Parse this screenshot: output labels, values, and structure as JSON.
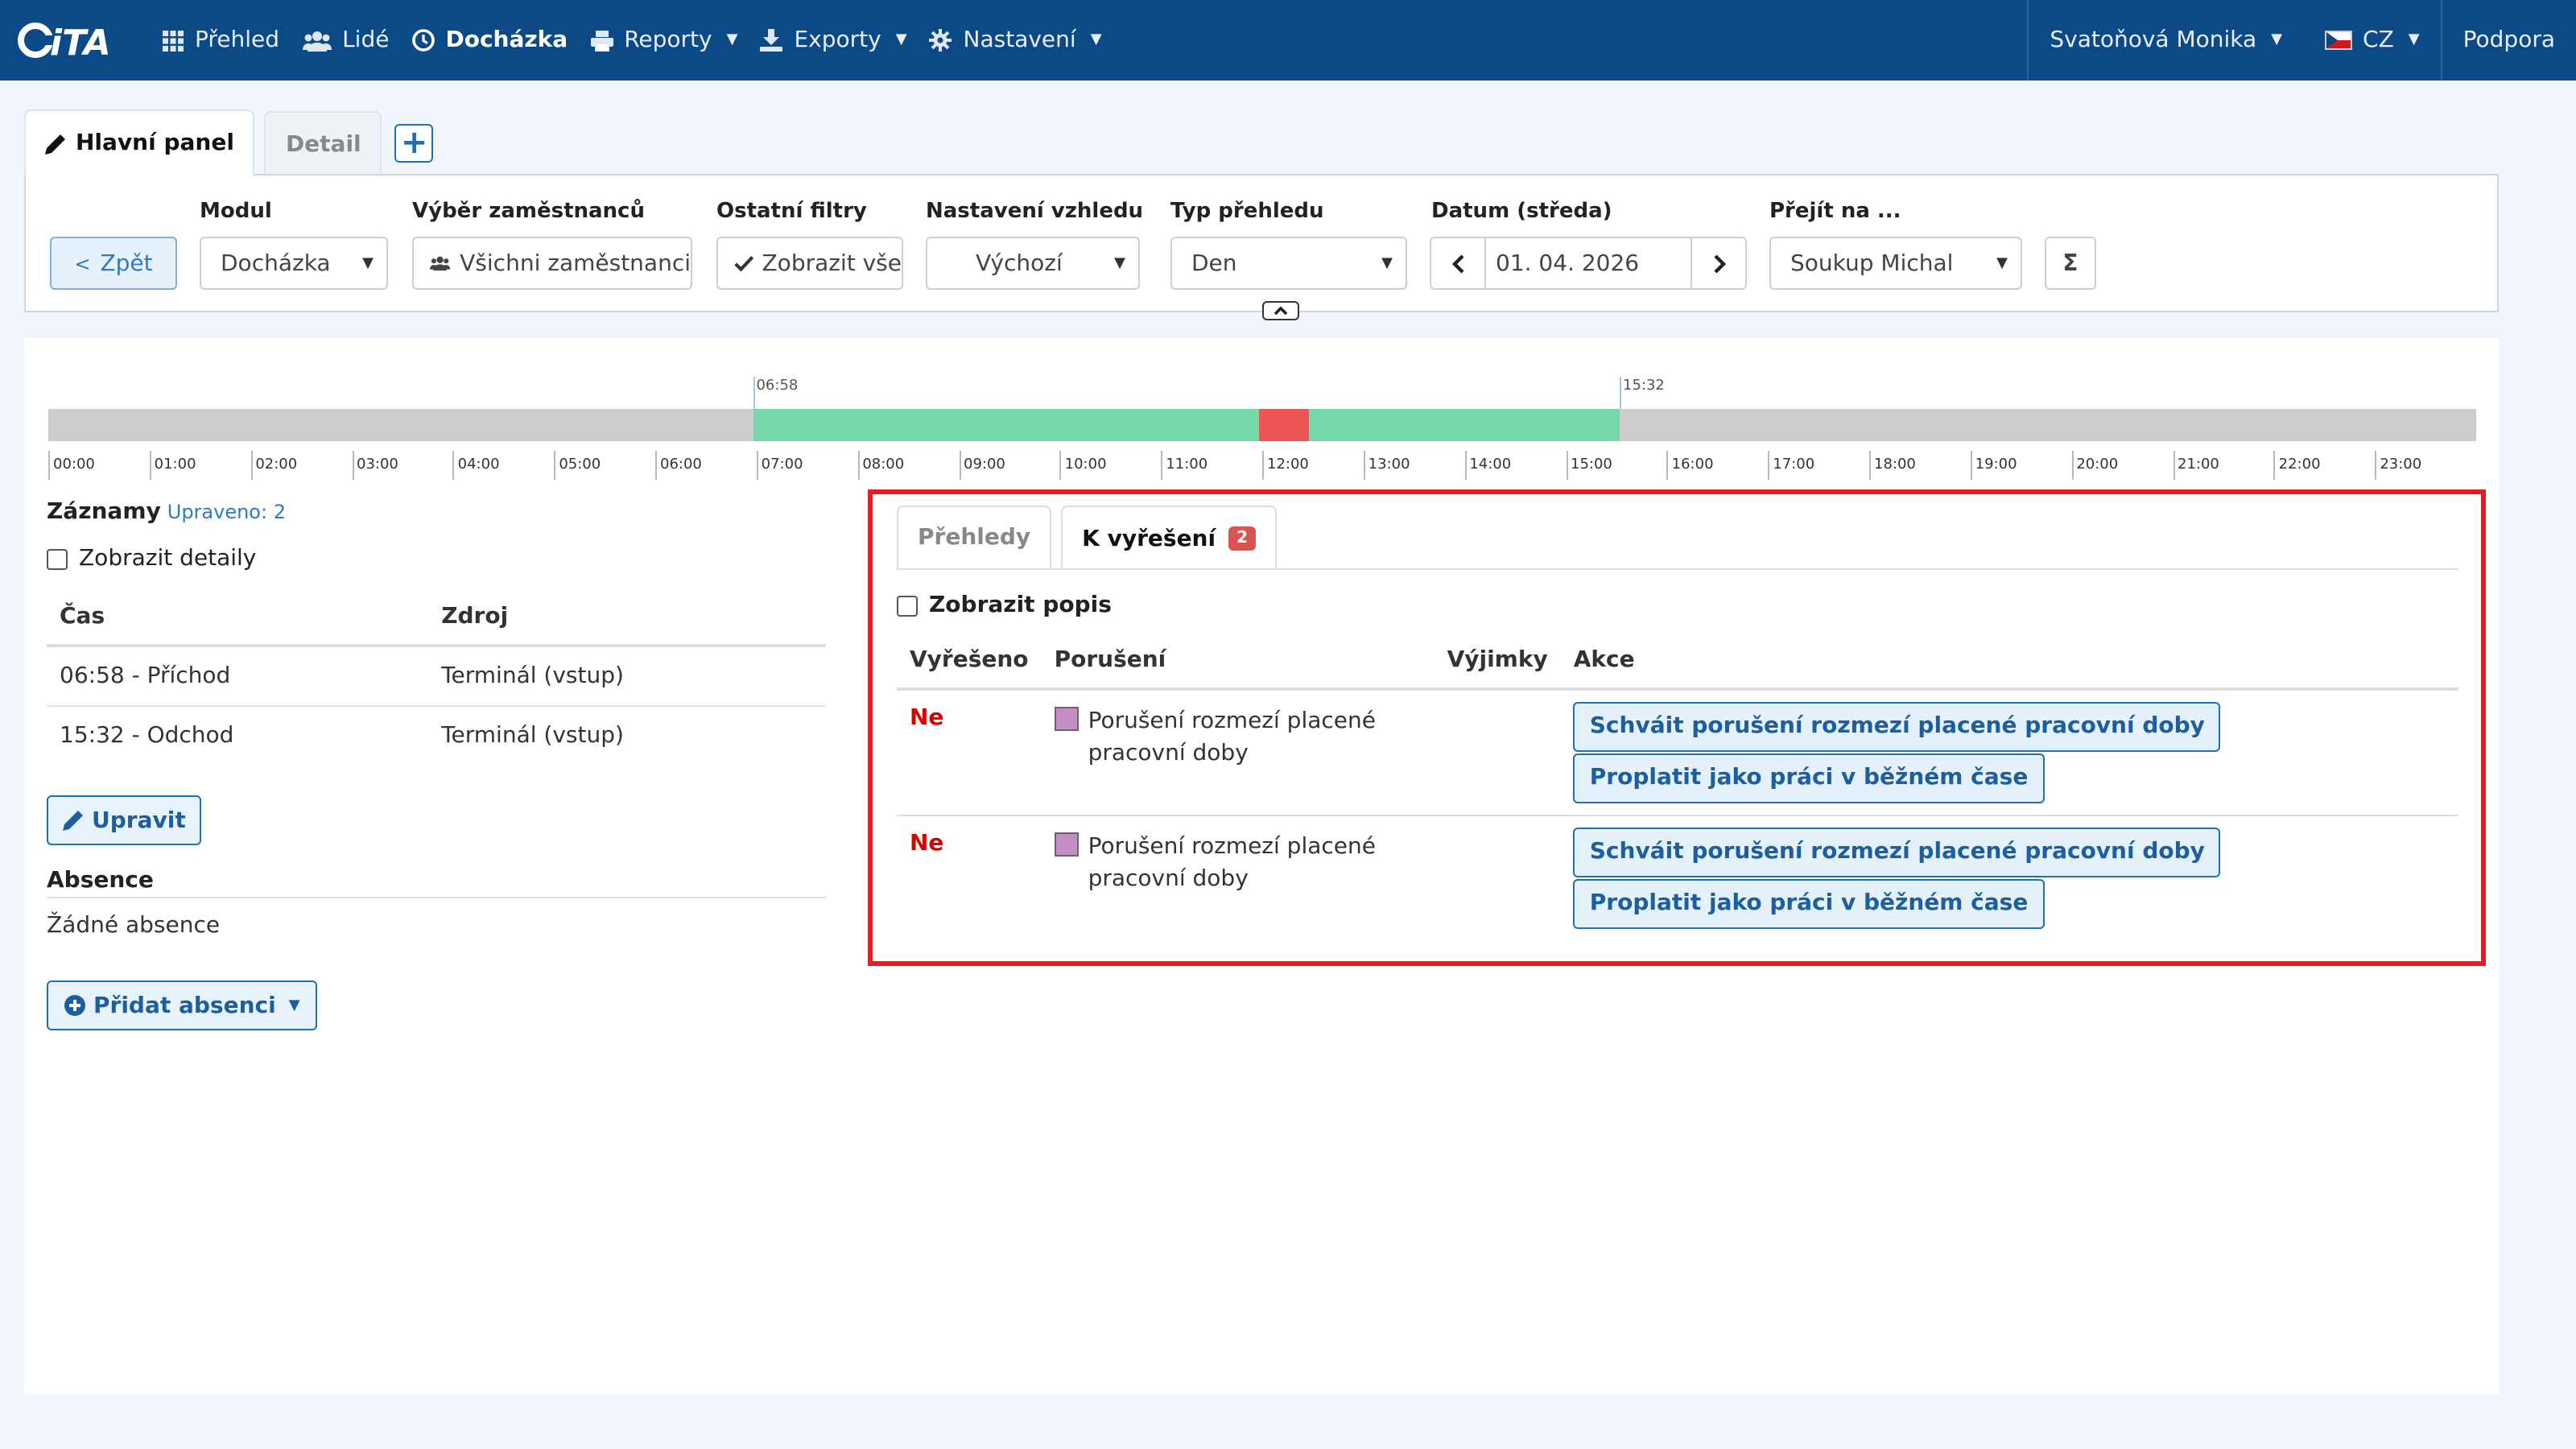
{
  "nav": {
    "logo": "CiTA",
    "items": [
      {
        "label": "Přehled",
        "icon": "grid-icon",
        "dropdown": false
      },
      {
        "label": "Lidé",
        "icon": "users-icon",
        "dropdown": false
      },
      {
        "label": "Docházka",
        "icon": "clock-icon",
        "dropdown": false,
        "active": true
      },
      {
        "label": "Reporty",
        "icon": "printer-icon",
        "dropdown": true
      },
      {
        "label": "Exporty",
        "icon": "download-icon",
        "dropdown": true
      },
      {
        "label": "Nastavení",
        "icon": "gear-icon",
        "dropdown": true
      }
    ],
    "user": "Svatoňová Monika",
    "language": "CZ",
    "support": "Podpora"
  },
  "tabs": {
    "main": "Hlavní panel",
    "detail": "Detail",
    "add": "+"
  },
  "filters": {
    "back": "Zpět",
    "module_label": "Modul",
    "module_value": "Docházka",
    "employees_label": "Výběr zaměstnanců",
    "employees_value": "Všichni zaměstnanci",
    "other_label": "Ostatní filtry",
    "other_value": "Zobrazit vše",
    "view_label": "Nastavení vzhledu",
    "view_value": "Výchozí",
    "type_label": "Typ přehledu",
    "type_value": "Den",
    "date_label": "Datum (středa)",
    "date_value": "01. 04. 2026",
    "goto_label": "Přejít na ...",
    "goto_value": "Soukup Michal",
    "sum": "Σ"
  },
  "timeline": {
    "hours": [
      "00:00",
      "01:00",
      "02:00",
      "03:00",
      "04:00",
      "05:00",
      "06:00",
      "07:00",
      "08:00",
      "09:00",
      "10:00",
      "11:00",
      "12:00",
      "13:00",
      "14:00",
      "15:00",
      "16:00",
      "17:00",
      "18:00",
      "19:00",
      "20:00",
      "21:00",
      "22:00",
      "23:00"
    ],
    "arrival": "06:58",
    "departure": "15:32",
    "break_start": "11:58",
    "break_end": "12:28",
    "work_color": "#77d9aa",
    "break_color": "#ef5555"
  },
  "records": {
    "title": "Záznamy",
    "edited": "Upraveno: 2",
    "show_details": "Zobrazit detaily",
    "col_time": "Čas",
    "col_source": "Zdroj",
    "rows": [
      {
        "time": "06:58 - Příchod",
        "source": "Terminál (vstup)"
      },
      {
        "time": "15:32 - Odchod",
        "source": "Terminál (vstup)"
      }
    ],
    "edit_button": "Upravit",
    "absence_title": "Absence",
    "no_absence": "Žádné absence",
    "add_absence": "Přidat absenci"
  },
  "issues": {
    "tab_overview": "Přehledy",
    "tab_resolve": "K vyřešení",
    "badge": "2",
    "show_desc": "Zobrazit popis",
    "col_resolved": "Vyřešeno",
    "col_violation": "Porušení",
    "col_exceptions": "Výjimky",
    "col_action": "Akce",
    "rows": [
      {
        "resolved": "Ne",
        "violation": "Porušení rozmezí placené pracovní doby",
        "exceptions": "",
        "action1": "Schváit porušení rozmezí placené pracovní doby",
        "action2": "Proplatit jako práci v běžném čase"
      },
      {
        "resolved": "Ne",
        "violation": "Porušení rozmezí placené pracovní doby",
        "exceptions": "",
        "action1": "Schváit porušení rozmezí placené pracovní doby",
        "action2": "Proplatit jako práci v běžném čase"
      }
    ]
  }
}
